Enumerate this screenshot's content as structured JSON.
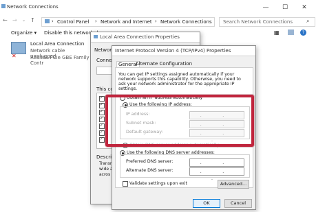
{
  "main_window": {
    "title": "Network Connections",
    "controls": {
      "minimize": "—",
      "maximize": "☐",
      "close": "✕"
    },
    "address": {
      "root": "Control Panel",
      "middle": "Network and Internet",
      "current": "Network Connections"
    },
    "search_placeholder": "Search Network Connections",
    "toolbar": {
      "organize": "Organize",
      "disable": "Disable this network de"
    },
    "adapter": {
      "name": "Local Area Connection",
      "status": "Network cable unplugged",
      "device": "Realtek PCIe GBE Family Contr"
    }
  },
  "lac_dialog": {
    "title": "Local Area Connection Properties",
    "tab": "Networking",
    "connect_label": "Connect",
    "items_label": "This con",
    "description_label": "Descrip",
    "description_lines": [
      "Transr",
      "wide a",
      "acros"
    ]
  },
  "ipv4_dialog": {
    "title": "Internet Protocol Version 4 (TCP/IPv4) Properties",
    "tabs": [
      "General",
      "Alternate Configuration"
    ],
    "intro": "You can get IP settings assigned automatically if your network supports this capability. Otherwise, you need to ask your network administrator for the appropriate IP settings.",
    "auto_ip": "Obtain an IP address automatically",
    "use_ip": "Use the following IP address:",
    "ip_address_label": "IP address:",
    "subnet_label": "Subnet mask:",
    "gateway_label": "Default gateway:",
    "ip_placeholder": ". . .",
    "auto_dns": "Obtain DNS server address automatically",
    "use_dns": "Use the following DNS server addresses:",
    "preferred_dns_label": "Preferred DNS server:",
    "alternate_dns_label": "Alternate DNS server:",
    "validate_label": "Validate settings upon exit",
    "advanced": "Advanced...",
    "ok": "OK",
    "cancel": "Cancel"
  },
  "colors": {
    "highlight": "#c0253d",
    "accent": "#0078d7"
  }
}
